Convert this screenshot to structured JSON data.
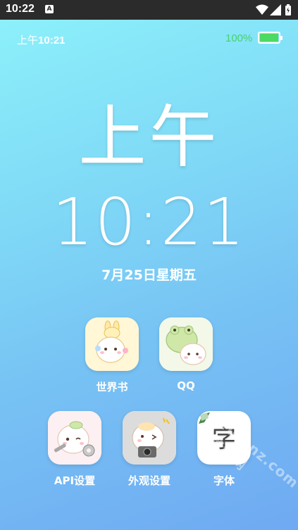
{
  "status_bar": {
    "time": "10:22",
    "notification_icon": "A"
  },
  "lock": {
    "top_time_prefix": "上午",
    "top_time": "10:21",
    "battery_percent": "100%",
    "battery_level": 1.0,
    "ampm": "上午",
    "time": "10:21",
    "date": "7月25日星期五"
  },
  "apps": [
    {
      "label": "世界书",
      "icon": "bunny-cat-icon"
    },
    {
      "label": "QQ",
      "icon": "frog-cat-icon"
    },
    {
      "label": "API设置",
      "icon": "wrench-cat-icon"
    },
    {
      "label": "外观设置",
      "icon": "camera-cat-icon"
    },
    {
      "label": "字体",
      "icon_text": "字",
      "icon": "font-icon"
    }
  ],
  "watermark": "fufunz.com 趣趣网",
  "colors": {
    "gradient_top": "#8cf0fa",
    "gradient_bottom": "#6fa9f2",
    "battery_green": "#4cd964",
    "status_bar": "#2b2b2b"
  }
}
